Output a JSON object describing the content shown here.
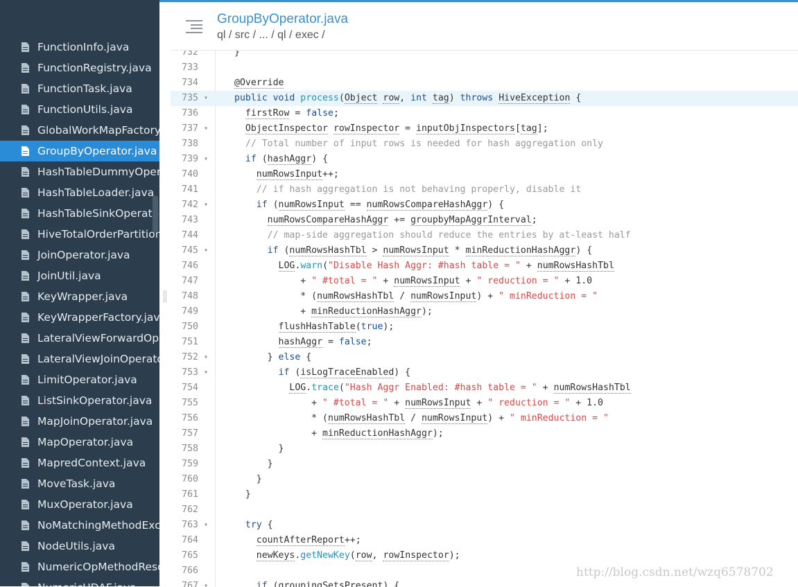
{
  "header": {
    "title": "GroupByOperator.java",
    "path": "ql / src / ... / ql / exec /"
  },
  "sidebar": {
    "items": [
      {
        "label": "FunctionInfo.java",
        "active": false
      },
      {
        "label": "FunctionRegistry.java",
        "active": false
      },
      {
        "label": "FunctionTask.java",
        "active": false
      },
      {
        "label": "FunctionUtils.java",
        "active": false
      },
      {
        "label": "GlobalWorkMapFactory.java",
        "active": false
      },
      {
        "label": "GroupByOperator.java",
        "active": true
      },
      {
        "label": "HashTableDummyOperator.java",
        "active": false
      },
      {
        "label": "HashTableLoader.java",
        "active": false
      },
      {
        "label": "HashTableSinkOperator.java",
        "active": false
      },
      {
        "label": "HiveTotalOrderPartitioner.java",
        "active": false
      },
      {
        "label": "JoinOperator.java",
        "active": false
      },
      {
        "label": "JoinUtil.java",
        "active": false
      },
      {
        "label": "KeyWrapper.java",
        "active": false
      },
      {
        "label": "KeyWrapperFactory.java",
        "active": false
      },
      {
        "label": "LateralViewForwardOperator.java",
        "active": false
      },
      {
        "label": "LateralViewJoinOperator.java",
        "active": false
      },
      {
        "label": "LimitOperator.java",
        "active": false
      },
      {
        "label": "ListSinkOperator.java",
        "active": false
      },
      {
        "label": "MapJoinOperator.java",
        "active": false
      },
      {
        "label": "MapOperator.java",
        "active": false
      },
      {
        "label": "MapredContext.java",
        "active": false
      },
      {
        "label": "MoveTask.java",
        "active": false
      },
      {
        "label": "MuxOperator.java",
        "active": false
      },
      {
        "label": "NoMatchingMethodException.java",
        "active": false
      },
      {
        "label": "NodeUtils.java",
        "active": false
      },
      {
        "label": "NumericOpMethodResolver.java",
        "active": false
      },
      {
        "label": "NumericUDAF.java",
        "active": false
      }
    ]
  },
  "code": {
    "highlight_line": "735",
    "lines": [
      {
        "n": "732",
        "fold": false,
        "tokens": [
          [
            "t",
            "}"
          ]
        ]
      },
      {
        "n": "733",
        "fold": false,
        "tokens": []
      },
      {
        "n": "734",
        "fold": false,
        "tokens": [
          [
            "u",
            "@Override"
          ]
        ]
      },
      {
        "n": "735",
        "fold": true,
        "tokens": [
          [
            "kw",
            "public "
          ],
          [
            "kw",
            "void "
          ],
          [
            "fn",
            "process"
          ],
          [
            "t",
            "("
          ],
          [
            "u",
            "Object"
          ],
          [
            "t",
            " "
          ],
          [
            "u",
            "row"
          ],
          [
            "t",
            ", "
          ],
          [
            "kw",
            "int "
          ],
          [
            "u",
            "tag"
          ],
          [
            "t",
            ") "
          ],
          [
            "kw",
            "throws "
          ],
          [
            "u",
            "HiveException"
          ],
          [
            "t",
            " {"
          ]
        ]
      },
      {
        "n": "736",
        "fold": false,
        "tokens": [
          [
            "t",
            "  "
          ],
          [
            "u",
            "firstRow"
          ],
          [
            "t",
            " = "
          ],
          [
            "kw",
            "false"
          ],
          [
            "t",
            ";"
          ]
        ]
      },
      {
        "n": "737",
        "fold": true,
        "tokens": [
          [
            "t",
            "  "
          ],
          [
            "u",
            "ObjectInspector"
          ],
          [
            "t",
            " "
          ],
          [
            "u",
            "rowInspector"
          ],
          [
            "t",
            " = "
          ],
          [
            "u",
            "inputObjInspectors"
          ],
          [
            "t",
            "["
          ],
          [
            "u",
            "tag"
          ],
          [
            "t",
            "];"
          ]
        ]
      },
      {
        "n": "738",
        "fold": false,
        "tokens": [
          [
            "t",
            "  "
          ],
          [
            "cm",
            "// Total number of input rows is needed for hash aggregation only"
          ]
        ]
      },
      {
        "n": "739",
        "fold": true,
        "tokens": [
          [
            "t",
            "  "
          ],
          [
            "kw",
            "if "
          ],
          [
            "t",
            "("
          ],
          [
            "u",
            "hashAggr"
          ],
          [
            "t",
            ") {"
          ]
        ]
      },
      {
        "n": "740",
        "fold": false,
        "tokens": [
          [
            "t",
            "    "
          ],
          [
            "u",
            "numRowsInput"
          ],
          [
            "t",
            "++;"
          ]
        ]
      },
      {
        "n": "741",
        "fold": false,
        "tokens": [
          [
            "t",
            "    "
          ],
          [
            "cm",
            "// if hash aggregation is not behaving properly, disable it"
          ]
        ]
      },
      {
        "n": "742",
        "fold": true,
        "tokens": [
          [
            "t",
            "    "
          ],
          [
            "kw",
            "if "
          ],
          [
            "t",
            "("
          ],
          [
            "u",
            "numRowsInput"
          ],
          [
            "t",
            " == "
          ],
          [
            "u",
            "numRowsCompareHashAggr"
          ],
          [
            "t",
            ") {"
          ]
        ]
      },
      {
        "n": "743",
        "fold": false,
        "tokens": [
          [
            "t",
            "      "
          ],
          [
            "u",
            "numRowsCompareHashAggr"
          ],
          [
            "t",
            " += "
          ],
          [
            "u",
            "groupbyMapAggrInterval"
          ],
          [
            "t",
            ";"
          ]
        ]
      },
      {
        "n": "744",
        "fold": false,
        "tokens": [
          [
            "t",
            "      "
          ],
          [
            "cm",
            "// map-side aggregation should reduce the entries by at-least half"
          ]
        ]
      },
      {
        "n": "745",
        "fold": true,
        "tokens": [
          [
            "t",
            "      "
          ],
          [
            "kw",
            "if "
          ],
          [
            "t",
            "("
          ],
          [
            "u",
            "numRowsHashTbl"
          ],
          [
            "t",
            " > "
          ],
          [
            "u",
            "numRowsInput"
          ],
          [
            "t",
            " * "
          ],
          [
            "u",
            "minReductionHashAggr"
          ],
          [
            "t",
            ") {"
          ]
        ]
      },
      {
        "n": "746",
        "fold": false,
        "tokens": [
          [
            "t",
            "        "
          ],
          [
            "u",
            "LOG"
          ],
          [
            "t",
            "."
          ],
          [
            "fn",
            "warn"
          ],
          [
            "t",
            "("
          ],
          [
            "str",
            "\"Disable Hash Aggr: #hash table = \""
          ],
          [
            "t",
            " + "
          ],
          [
            "u",
            "numRowsHashTbl"
          ]
        ]
      },
      {
        "n": "747",
        "fold": false,
        "tokens": [
          [
            "t",
            "            + "
          ],
          [
            "str",
            "\" #total = \""
          ],
          [
            "t",
            " + "
          ],
          [
            "u",
            "numRowsInput"
          ],
          [
            "t",
            " + "
          ],
          [
            "str",
            "\" reduction = \""
          ],
          [
            "t",
            " + 1.0"
          ]
        ]
      },
      {
        "n": "748",
        "fold": false,
        "tokens": [
          [
            "t",
            "            * ("
          ],
          [
            "u",
            "numRowsHashTbl"
          ],
          [
            "t",
            " / "
          ],
          [
            "u",
            "numRowsInput"
          ],
          [
            "t",
            ") + "
          ],
          [
            "str",
            "\" minReduction = \""
          ]
        ]
      },
      {
        "n": "749",
        "fold": false,
        "tokens": [
          [
            "t",
            "            + "
          ],
          [
            "u",
            "minReductionHashAggr"
          ],
          [
            "t",
            ");"
          ]
        ]
      },
      {
        "n": "750",
        "fold": false,
        "tokens": [
          [
            "t",
            "        "
          ],
          [
            "u",
            "flushHashTable"
          ],
          [
            "t",
            "("
          ],
          [
            "kw",
            "true"
          ],
          [
            "t",
            ");"
          ]
        ]
      },
      {
        "n": "751",
        "fold": false,
        "tokens": [
          [
            "t",
            "        "
          ],
          [
            "u",
            "hashAggr"
          ],
          [
            "t",
            " = "
          ],
          [
            "kw",
            "false"
          ],
          [
            "t",
            ";"
          ]
        ]
      },
      {
        "n": "752",
        "fold": true,
        "tokens": [
          [
            "t",
            "      } "
          ],
          [
            "kw",
            "else "
          ],
          [
            "t",
            "{"
          ]
        ]
      },
      {
        "n": "753",
        "fold": true,
        "tokens": [
          [
            "t",
            "        "
          ],
          [
            "kw",
            "if "
          ],
          [
            "t",
            "("
          ],
          [
            "u",
            "isLogTraceEnabled"
          ],
          [
            "t",
            ") {"
          ]
        ]
      },
      {
        "n": "754",
        "fold": false,
        "tokens": [
          [
            "t",
            "          "
          ],
          [
            "u",
            "LOG"
          ],
          [
            "t",
            "."
          ],
          [
            "fn",
            "trace"
          ],
          [
            "t",
            "("
          ],
          [
            "str",
            "\"Hash Aggr Enabled: #hash table = \""
          ],
          [
            "t",
            " + "
          ],
          [
            "u",
            "numRowsHashTbl"
          ]
        ]
      },
      {
        "n": "755",
        "fold": false,
        "tokens": [
          [
            "t",
            "              + "
          ],
          [
            "str",
            "\" #total = \""
          ],
          [
            "t",
            " + "
          ],
          [
            "u",
            "numRowsInput"
          ],
          [
            "t",
            " + "
          ],
          [
            "str",
            "\" reduction = \""
          ],
          [
            "t",
            " + 1.0"
          ]
        ]
      },
      {
        "n": "756",
        "fold": false,
        "tokens": [
          [
            "t",
            "              * ("
          ],
          [
            "u",
            "numRowsHashTbl"
          ],
          [
            "t",
            " / "
          ],
          [
            "u",
            "numRowsInput"
          ],
          [
            "t",
            ") + "
          ],
          [
            "str",
            "\" minReduction = \""
          ]
        ]
      },
      {
        "n": "757",
        "fold": false,
        "tokens": [
          [
            "t",
            "              + "
          ],
          [
            "u",
            "minReductionHashAggr"
          ],
          [
            "t",
            ");"
          ]
        ]
      },
      {
        "n": "758",
        "fold": false,
        "tokens": [
          [
            "t",
            "        }"
          ]
        ]
      },
      {
        "n": "759",
        "fold": false,
        "tokens": [
          [
            "t",
            "      }"
          ]
        ]
      },
      {
        "n": "760",
        "fold": false,
        "tokens": [
          [
            "t",
            "    }"
          ]
        ]
      },
      {
        "n": "761",
        "fold": false,
        "tokens": [
          [
            "t",
            "  }"
          ]
        ]
      },
      {
        "n": "762",
        "fold": false,
        "tokens": []
      },
      {
        "n": "763",
        "fold": true,
        "tokens": [
          [
            "t",
            "  "
          ],
          [
            "kw",
            "try "
          ],
          [
            "t",
            "{"
          ]
        ]
      },
      {
        "n": "764",
        "fold": false,
        "tokens": [
          [
            "t",
            "    "
          ],
          [
            "u",
            "countAfterReport"
          ],
          [
            "t",
            "++;"
          ]
        ]
      },
      {
        "n": "765",
        "fold": false,
        "tokens": [
          [
            "t",
            "    "
          ],
          [
            "u",
            "newKeys"
          ],
          [
            "t",
            "."
          ],
          [
            "fn",
            "getNewKey"
          ],
          [
            "t",
            "("
          ],
          [
            "u",
            "row"
          ],
          [
            "t",
            ", "
          ],
          [
            "u",
            "rowInspector"
          ],
          [
            "t",
            ");"
          ]
        ]
      },
      {
        "n": "766",
        "fold": false,
        "tokens": []
      },
      {
        "n": "767",
        "fold": true,
        "tokens": [
          [
            "t",
            "    "
          ],
          [
            "kw",
            "if "
          ],
          [
            "t",
            "("
          ],
          [
            "u",
            "groupingSetsPresent"
          ],
          [
            "t",
            ") {"
          ]
        ]
      }
    ]
  },
  "watermark": "http://blog.csdn.net/wzq6578702",
  "colors": {
    "sidebar_bg": "#2c3e4d",
    "active_item": "#2a8bd6",
    "accent": "#3a8fd0",
    "keyword": "#1d4e8f",
    "string": "#d14b4b",
    "comment": "#999999",
    "function": "#2a8fb5"
  },
  "icons": {
    "file": "file-icon",
    "menu": "hamburger-menu-icon",
    "fold": "fold-arrow-icon"
  }
}
